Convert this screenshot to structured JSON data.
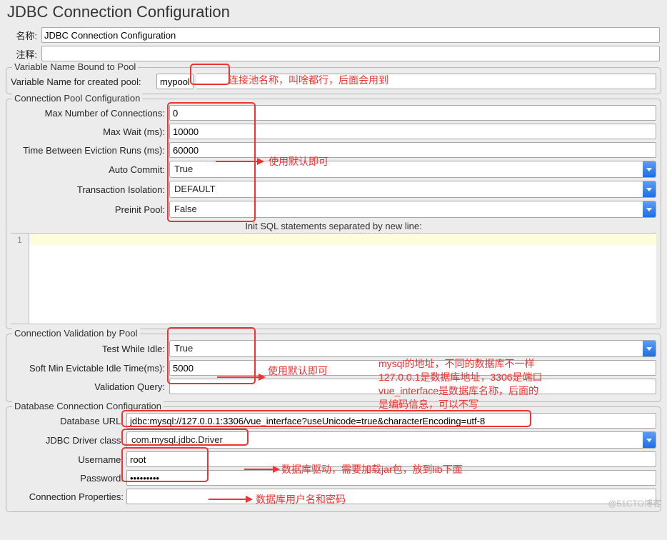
{
  "title": "JDBC Connection Configuration",
  "header": {
    "name_label": "名称:",
    "name_value": "JDBC Connection Configuration",
    "comment_label": "注释:",
    "comment_value": ""
  },
  "sections": {
    "varpool": {
      "legend": "Variable Name Bound to Pool",
      "var_label": "Variable Name for created pool:",
      "var_value": "mypool"
    },
    "pool": {
      "legend": "Connection Pool Configuration",
      "max_conn_label": "Max Number of Connections:",
      "max_conn_value": "0",
      "max_wait_label": "Max Wait (ms):",
      "max_wait_value": "10000",
      "eviction_label": "Time Between Eviction Runs (ms):",
      "eviction_value": "60000",
      "auto_commit_label": "Auto Commit:",
      "auto_commit_value": "True",
      "iso_label": "Transaction Isolation:",
      "iso_value": "DEFAULT",
      "preinit_label": "Preinit Pool:",
      "preinit_value": "False",
      "init_sql_caption": "Init SQL statements separated by new line:",
      "gutter_1": "1"
    },
    "validation": {
      "legend": "Connection Validation by Pool",
      "test_idle_label": "Test While Idle:",
      "test_idle_value": "True",
      "soft_min_label": "Soft Min Evictable Idle Time(ms):",
      "soft_min_value": "5000",
      "vquery_label": "Validation Query:",
      "vquery_value": ""
    },
    "db": {
      "legend": "Database Connection Configuration",
      "url_label": "Database URL:",
      "url_value": "jdbc:mysql://127.0.0.1:3306/vue_interface?useUnicode=true&characterEncoding=utf-8",
      "driver_label": "JDBC Driver class:",
      "driver_value": "com.mysql.jdbc.Driver",
      "user_label": "Username:",
      "user_value": "root",
      "pass_label": "Password:",
      "pass_value": "•••••••••",
      "props_label": "Connection Properties:",
      "props_value": ""
    }
  },
  "annotations": {
    "a1": "连接池名称，叫啥都行，后面会用到",
    "a2": "使用默认即可",
    "a3": "使用默认即可",
    "a4": "mysql的地址，不同的数据库不一样\n127.0.0.1是数据库地址，3306是端口\nvue_interface是数据库名称，后面的\n是编码信息，可以不写",
    "a5": "数据库驱动，需要加载jar包，放到lib下面",
    "a6": "数据库用户名和密码"
  },
  "watermark": "@51CTO博客"
}
